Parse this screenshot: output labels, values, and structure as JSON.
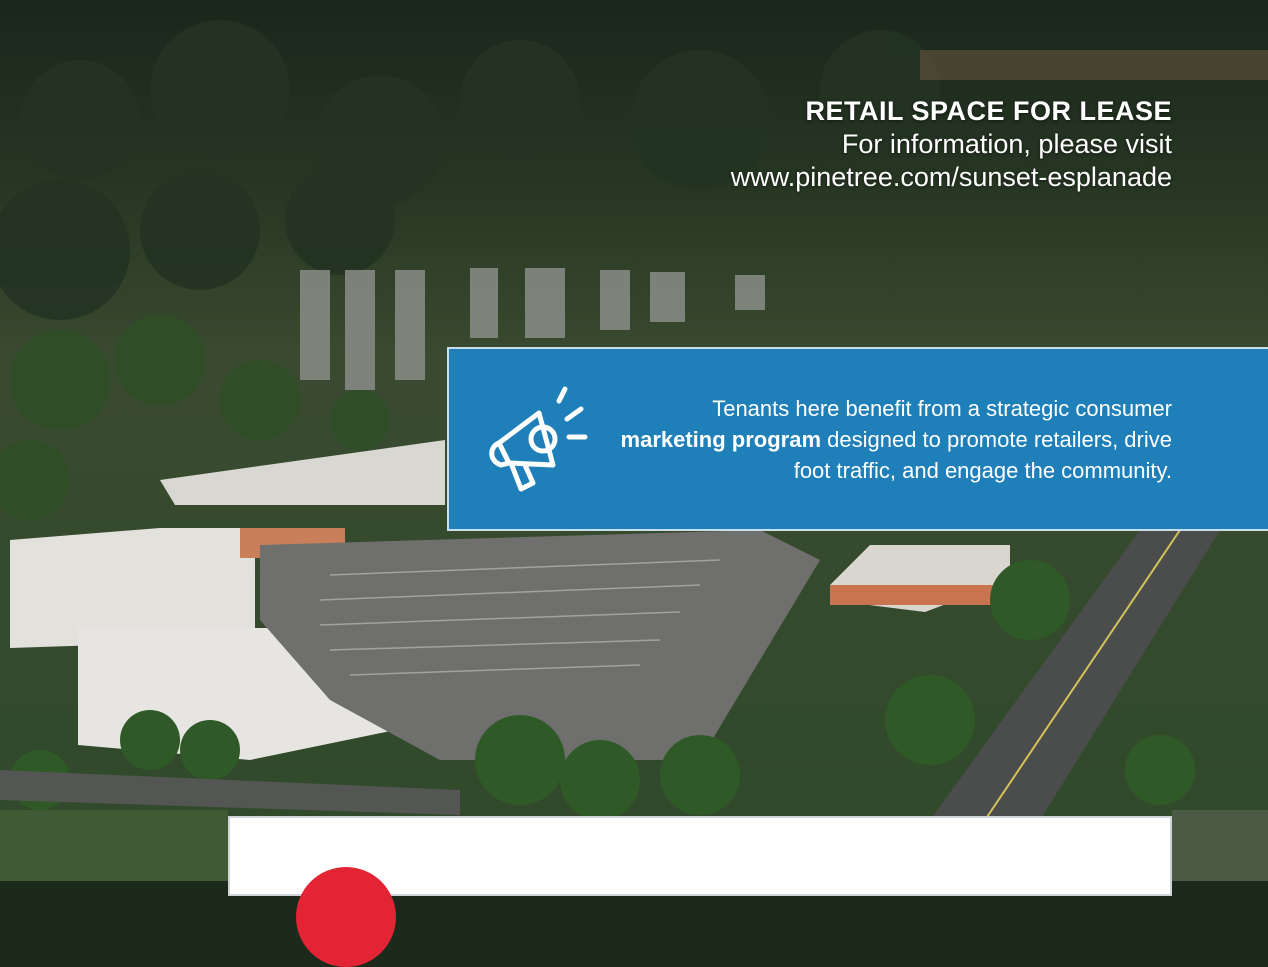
{
  "heading": {
    "title": "RETAIL SPACE FOR LEASE",
    "line1": "For information, please visit",
    "line2": "www.pinetree.com/sunset-esplanade"
  },
  "promo": {
    "text_before": "Tenants here benefit from a strategic consumer",
    "text_bold": "marketing program",
    "text_after": "designed to promote retailers, drive foot traffic, and engage the community.",
    "icon": "megaphone-icon",
    "background": "#1f7fb9"
  },
  "colors": {
    "badge": "#e32434",
    "card": "#ffffff"
  }
}
